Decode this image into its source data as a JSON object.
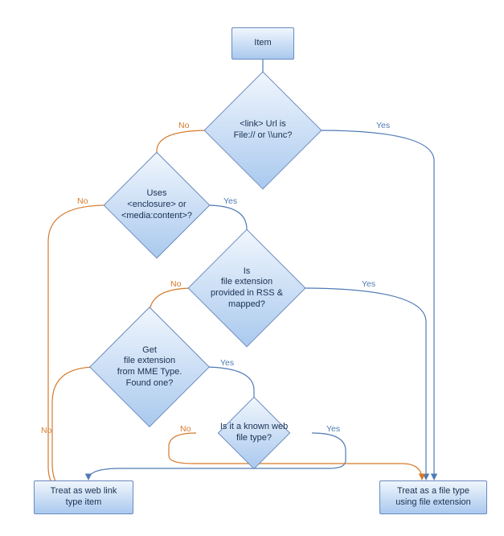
{
  "chart_data": {
    "type": "flowchart",
    "title": "",
    "nodes": [
      {
        "id": "n_item",
        "shape": "rect",
        "label": "Item"
      },
      {
        "id": "n_link",
        "shape": "diamond",
        "label": "<link> Url is\nFile:// or \\\\unc?"
      },
      {
        "id": "n_encl",
        "shape": "diamond",
        "label": "Uses\n<enclosure> or\n<media:content>?"
      },
      {
        "id": "n_rssmap",
        "shape": "diamond",
        "label": "Is\nfile extension\nprovided in RSS &\nmapped?"
      },
      {
        "id": "n_mime",
        "shape": "diamond",
        "label": "Get\nfile extension\nfrom MME Type.\nFound one?"
      },
      {
        "id": "n_webtype",
        "shape": "diamond",
        "label": "Is it a known web\nfile type?"
      },
      {
        "id": "n_weblink",
        "shape": "rect",
        "label": "Treat as web link\ntype item"
      },
      {
        "id": "n_filetype",
        "shape": "rect",
        "label": "Treat as a file type\nusing file extension"
      }
    ],
    "edges": [
      {
        "from": "n_item",
        "to": "n_link",
        "label": ""
      },
      {
        "from": "n_link",
        "to": "n_filetype",
        "label": "Yes"
      },
      {
        "from": "n_link",
        "to": "n_encl",
        "label": "No"
      },
      {
        "from": "n_encl",
        "to": "n_rssmap",
        "label": "Yes"
      },
      {
        "from": "n_encl",
        "to": "n_weblink",
        "label": "No"
      },
      {
        "from": "n_rssmap",
        "to": "n_filetype",
        "label": "Yes"
      },
      {
        "from": "n_rssmap",
        "to": "n_mime",
        "label": "No"
      },
      {
        "from": "n_mime",
        "to": "n_webtype",
        "label": "Yes"
      },
      {
        "from": "n_mime",
        "to": "n_weblink",
        "label": "No"
      },
      {
        "from": "n_webtype",
        "to": "n_weblink",
        "label": "Yes"
      },
      {
        "from": "n_webtype",
        "to": "n_filetype",
        "label": "No"
      }
    ]
  },
  "nodes": {
    "item": "Item",
    "link": "<link> Url is\nFile:// or \\\\unc?",
    "encl": "Uses\n<enclosure> or\n<media:content>?",
    "rssmap": "Is\nfile extension\nprovided in RSS &\nmapped?",
    "mime": "Get\nfile extension\nfrom MME Type.\nFound one?",
    "webtype": "Is it a known web\nfile type?",
    "weblink": "Treat as web link\ntype item",
    "filetype": "Treat as a file type\nusing file extension"
  },
  "labels": {
    "yes": "Yes",
    "no": "No"
  }
}
